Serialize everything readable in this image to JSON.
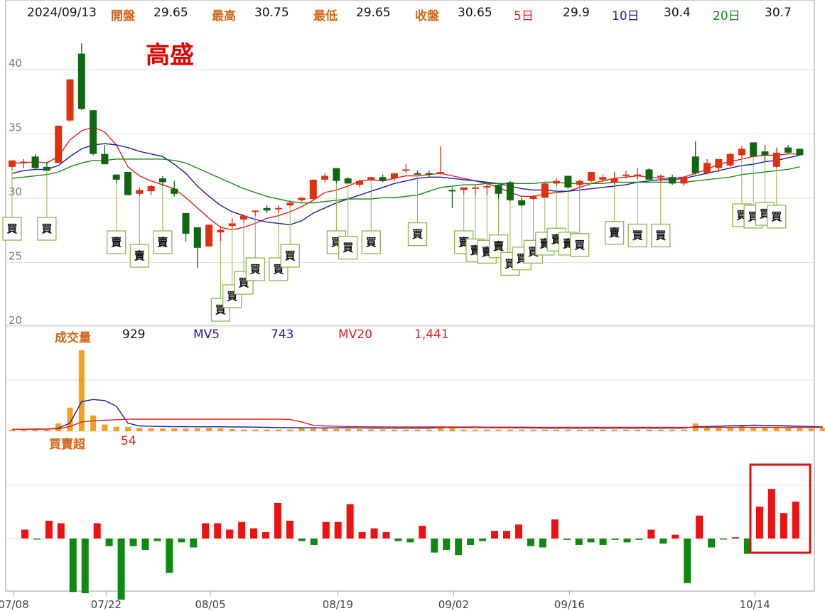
{
  "header": {
    "date": "2024/09/13",
    "open_label": "開盤",
    "open": "29.65",
    "high_label": "最高",
    "high": "30.75",
    "low_label": "最低",
    "low": "29.65",
    "close_label": "收盤",
    "close": "30.65",
    "ma5_label": "5日",
    "ma5": "29.9",
    "ma10_label": "10日",
    "ma10": "30.4",
    "ma20_label": "20日",
    "ma20": "30.7"
  },
  "stock_name": "高盛",
  "volume_panel": {
    "label": "成交量",
    "value": "929",
    "mv5_label": "MV5",
    "mv5": "743",
    "mv20_label": "MV20",
    "mv20": "1,441"
  },
  "net_panel": {
    "label": "買賣超",
    "value": "54"
  },
  "signal_text": {
    "buy": "買",
    "sell": "賣"
  },
  "colors": {
    "up": "#e03010",
    "down": "#116611",
    "ma5": "#e02020",
    "ma10": "#1a1ab0",
    "ma20": "#1a8a1a",
    "volume": "#f5a020",
    "net_pos": "#ee1111",
    "net_neg": "#118811",
    "label_orange": "#d2691e",
    "highlight_box": "#dd1111",
    "signal_border": "#8ab84a"
  },
  "chart_data": [
    {
      "type": "candlestick",
      "title": "",
      "y_ticks": [
        20,
        25,
        30,
        35,
        40
      ],
      "ylim": [
        20,
        42
      ],
      "x_ticks": [
        "07/08",
        "07/22",
        "08/05",
        "08/19",
        "09/02",
        "09/16",
        "10/14"
      ],
      "x_tick_positions": [
        0,
        8,
        17,
        28,
        38,
        48,
        64
      ],
      "ohlc": [
        [
          32.0,
          32.5,
          31.8,
          32.5
        ],
        [
          32.3,
          32.6,
          31.9,
          32.4
        ],
        [
          32.8,
          33.0,
          31.8,
          31.9
        ],
        [
          32.0,
          32.4,
          31.7,
          31.7
        ],
        [
          32.3,
          35.2,
          32.3,
          35.2
        ],
        [
          35.6,
          38.8,
          35.5,
          38.8
        ],
        [
          40.8,
          41.6,
          36.4,
          36.5
        ],
        [
          36.4,
          36.4,
          32.9,
          33.0
        ],
        [
          33.0,
          33.7,
          32.2,
          32.2
        ],
        [
          31.4,
          31.4,
          30.7,
          31.0
        ],
        [
          31.6,
          31.6,
          29.8,
          29.8
        ],
        [
          29.9,
          30.4,
          29.7,
          30.2
        ],
        [
          30.1,
          30.6,
          29.8,
          30.5
        ],
        [
          31.1,
          31.3,
          30.5,
          30.8
        ],
        [
          30.3,
          30.9,
          29.7,
          29.9
        ],
        [
          28.4,
          28.4,
          26.2,
          26.8
        ],
        [
          27.3,
          27.3,
          24.1,
          25.7
        ],
        [
          25.8,
          27.5,
          25.8,
          27.5
        ],
        [
          26.9,
          27.4,
          26.2,
          27.1
        ],
        [
          27.4,
          28.0,
          27.2,
          27.6
        ],
        [
          27.9,
          28.3,
          27.7,
          28.2
        ],
        [
          28.5,
          28.6,
          28.2,
          28.6
        ],
        [
          28.8,
          29.0,
          28.4,
          28.6
        ],
        [
          28.7,
          29.0,
          28.4,
          28.8
        ],
        [
          29.0,
          29.4,
          28.9,
          29.2
        ],
        [
          29.4,
          29.6,
          29.3,
          29.6
        ],
        [
          29.5,
          31.0,
          29.4,
          31.0
        ],
        [
          31.0,
          31.5,
          30.8,
          31.3
        ],
        [
          31.9,
          31.9,
          30.7,
          30.9
        ],
        [
          31.1,
          31.2,
          30.7,
          30.7
        ],
        [
          30.6,
          31.0,
          30.4,
          30.9
        ],
        [
          31.0,
          31.2,
          30.9,
          31.2
        ],
        [
          31.2,
          31.4,
          30.8,
          30.9
        ],
        [
          31.1,
          31.5,
          30.9,
          31.5
        ],
        [
          31.7,
          32.2,
          31.5,
          31.8
        ],
        [
          31.5,
          31.7,
          31.4,
          31.4
        ],
        [
          31.5,
          31.7,
          31.2,
          31.4
        ],
        [
          31.5,
          33.6,
          31.4,
          31.6
        ],
        [
          30.2,
          30.4,
          28.8,
          30.1
        ],
        [
          30.2,
          30.4,
          29.9,
          30.4
        ],
        [
          30.4,
          30.6,
          29.8,
          30.4
        ],
        [
          30.5,
          30.7,
          29.8,
          30.5
        ],
        [
          30.6,
          30.7,
          29.5,
          29.9
        ],
        [
          30.8,
          30.9,
          29.3,
          29.4
        ],
        [
          29.4,
          29.6,
          28.9,
          29.0
        ],
        [
          29.5,
          29.8,
          29.4,
          29.7
        ],
        [
          29.6,
          30.8,
          29.6,
          30.7
        ],
        [
          30.7,
          31.1,
          30.5,
          30.9
        ],
        [
          31.3,
          31.3,
          30.3,
          30.4
        ],
        [
          30.6,
          31.0,
          30.4,
          30.9
        ],
        [
          30.9,
          31.6,
          30.8,
          31.6
        ],
        [
          31.0,
          31.4,
          30.8,
          31.2
        ],
        [
          30.8,
          31.6,
          30.6,
          31.1
        ],
        [
          31.3,
          31.7,
          31.1,
          31.4
        ],
        [
          31.4,
          31.9,
          31.0,
          31.4
        ],
        [
          31.8,
          31.9,
          31.0,
          31.0
        ],
        [
          31.2,
          31.4,
          30.8,
          31.3
        ],
        [
          31.2,
          31.4,
          30.6,
          30.7
        ],
        [
          30.7,
          31.2,
          30.5,
          31.2
        ],
        [
          32.8,
          34.0,
          31.4,
          31.5
        ],
        [
          31.5,
          32.6,
          31.4,
          32.3
        ],
        [
          31.9,
          32.6,
          31.6,
          32.6
        ],
        [
          32.1,
          33.1,
          32.0,
          33.0
        ],
        [
          32.9,
          33.6,
          32.7,
          33.4
        ],
        [
          33.9,
          33.9,
          32.8,
          32.8
        ],
        [
          33.2,
          33.7,
          32.4,
          32.9
        ],
        [
          32.0,
          33.5,
          31.9,
          33.1
        ],
        [
          33.5,
          33.7,
          33.0,
          33.1
        ],
        [
          33.4,
          33.4,
          32.9,
          32.9
        ]
      ],
      "series": [
        {
          "name": "5日",
          "values": [
            32.3,
            32.3,
            32.4,
            32.3,
            32.8,
            34.1,
            34.8,
            35.1,
            34.7,
            33.7,
            32.0,
            31.3,
            30.9,
            30.6,
            30.3,
            29.6,
            28.8,
            28.0,
            27.3,
            27.1,
            27.3,
            27.6,
            28.0,
            28.2,
            28.5,
            28.9,
            29.4,
            30.0,
            30.2,
            30.5,
            30.9,
            31.0,
            30.9,
            31.1,
            31.3,
            31.3,
            31.4,
            31.5,
            31.3,
            31.1,
            30.9,
            30.7,
            30.4,
            30.0,
            29.7,
            29.7,
            29.9,
            30.0,
            30.1,
            30.4,
            30.7,
            30.9,
            31.1,
            31.2,
            31.3,
            31.2,
            31.1,
            31.1,
            31.2,
            31.5,
            31.8,
            32.2,
            32.4,
            32.6,
            32.8,
            32.9,
            32.9,
            33.0,
            33.0
          ]
        },
        {
          "name": "10日",
          "values": [
            31.5,
            31.7,
            31.8,
            31.8,
            32.1,
            32.8,
            33.4,
            33.7,
            33.8,
            33.7,
            33.5,
            33.2,
            33.0,
            32.8,
            32.2,
            31.5,
            30.5,
            29.7,
            29.0,
            28.5,
            28.2,
            27.9,
            27.7,
            27.6,
            27.5,
            27.8,
            28.4,
            28.8,
            29.2,
            29.5,
            29.8,
            30.1,
            30.4,
            30.7,
            30.9,
            31.1,
            31.2,
            31.2,
            31.1,
            31.0,
            30.9,
            30.8,
            30.7,
            30.5,
            30.3,
            30.2,
            30.2,
            30.1,
            30.1,
            30.2,
            30.3,
            30.4,
            30.5,
            30.6,
            30.8,
            30.9,
            31.0,
            31.0,
            31.1,
            31.3,
            31.5,
            31.7,
            31.9,
            32.1,
            32.2,
            32.4,
            32.5,
            32.7,
            32.9
          ]
        },
        {
          "name": "20日",
          "values": [
            31.1,
            31.2,
            31.3,
            31.4,
            31.6,
            32.0,
            32.3,
            32.5,
            32.5,
            32.6,
            32.6,
            32.6,
            32.6,
            32.6,
            32.5,
            32.3,
            31.9,
            31.5,
            31.1,
            30.7,
            30.3,
            30.0,
            29.7,
            29.5,
            29.3,
            29.2,
            29.2,
            29.3,
            29.4,
            29.5,
            29.5,
            29.5,
            29.6,
            29.6,
            29.7,
            29.8,
            30.1,
            30.4,
            30.5,
            30.6,
            30.6,
            30.7,
            30.7,
            30.7,
            30.7,
            30.7,
            30.8,
            30.8,
            30.7,
            30.7,
            30.7,
            30.7,
            30.8,
            30.8,
            30.8,
            30.8,
            30.8,
            30.8,
            30.8,
            30.9,
            31.0,
            31.1,
            31.2,
            31.4,
            31.5,
            31.6,
            31.7,
            31.8,
            32.0
          ]
        }
      ],
      "signals": [
        {
          "i": 0,
          "type": "buy",
          "level": 0
        },
        {
          "i": 3,
          "type": "buy",
          "level": 0
        },
        {
          "i": 9,
          "type": "sell",
          "level": 1
        },
        {
          "i": 11,
          "type": "sell",
          "level": 2
        },
        {
          "i": 13,
          "type": "sell",
          "level": 1
        },
        {
          "i": 18,
          "type": "buy",
          "level": 6
        },
        {
          "i": 19,
          "type": "buy",
          "level": 5
        },
        {
          "i": 20,
          "type": "buy",
          "level": 4
        },
        {
          "i": 21,
          "type": "buy",
          "level": 3
        },
        {
          "i": 23,
          "type": "buy",
          "level": 3
        },
        {
          "i": 24,
          "type": "buy",
          "level": 2
        },
        {
          "i": 28,
          "type": "buy",
          "level": 1
        },
        {
          "i": 29,
          "type": "buy",
          "level": 1.4
        },
        {
          "i": 31,
          "type": "buy",
          "level": 1
        },
        {
          "i": 35,
          "type": "buy",
          "level": 0.4
        },
        {
          "i": 39,
          "type": "sell",
          "level": 1
        },
        {
          "i": 40,
          "type": "sell",
          "level": 1.6
        },
        {
          "i": 41,
          "type": "sell",
          "level": 1.7
        },
        {
          "i": 42,
          "type": "sell",
          "level": 1.3
        },
        {
          "i": 43,
          "type": "buy",
          "level": 2.6
        },
        {
          "i": 44,
          "type": "buy",
          "level": 2.2
        },
        {
          "i": 45,
          "type": "buy",
          "level": 1.7
        },
        {
          "i": 46,
          "type": "sell",
          "level": 1.1
        },
        {
          "i": 47,
          "type": "sell",
          "level": 0.8
        },
        {
          "i": 48,
          "type": "sell",
          "level": 1.1
        },
        {
          "i": 49,
          "type": "buy",
          "level": 1.2
        },
        {
          "i": 52,
          "type": "sell",
          "level": 0.3
        },
        {
          "i": 54,
          "type": "buy",
          "level": 0.5
        },
        {
          "i": 56,
          "type": "buy",
          "level": 0.5
        },
        {
          "i": 63,
          "type": "buy",
          "level": -1
        },
        {
          "i": 64,
          "type": "buy",
          "level": -0.9
        },
        {
          "i": 65,
          "type": "buy",
          "level": -1.1
        },
        {
          "i": 66,
          "type": "buy",
          "level": -0.9
        }
      ]
    },
    {
      "type": "bar",
      "title": "成交量",
      "values": [
        60,
        60,
        80,
        80,
        700,
        2100,
        7200,
        1400,
        600,
        400,
        380,
        300,
        280,
        250,
        250,
        250,
        280,
        300,
        280,
        200,
        150,
        150,
        150,
        150,
        150,
        300,
        300,
        250,
        200,
        200,
        180,
        160,
        160,
        150,
        150,
        150,
        150,
        420,
        280,
        150,
        150,
        150,
        150,
        150,
        150,
        150,
        150,
        150,
        150,
        150,
        150,
        150,
        150,
        150,
        150,
        150,
        150,
        150,
        150,
        700,
        350,
        300,
        400,
        450,
        350,
        300,
        320,
        300,
        280,
        250,
        260
      ],
      "series": [
        {
          "name": "MV5",
          "values": [
            50,
            50,
            60,
            60,
            150,
            600,
            2500,
            2700,
            2600,
            2100,
            600,
            350,
            320,
            300,
            280,
            280,
            270,
            270,
            270,
            260,
            250,
            240,
            220,
            200,
            190,
            180,
            180,
            170,
            180,
            190,
            170,
            160,
            160,
            150,
            150,
            160,
            160,
            200,
            210,
            200,
            200,
            200,
            190,
            180,
            170,
            170,
            160,
            160,
            160,
            160,
            160,
            160,
            160,
            150,
            150,
            150,
            150,
            150,
            150,
            270,
            300,
            320,
            360,
            380,
            420,
            400,
            380,
            350,
            320,
            300,
            250
          ]
        },
        {
          "name": "MV20",
          "values": [
            50,
            50,
            60,
            60,
            100,
            300,
            700,
            800,
            850,
            900,
            950,
            950,
            950,
            950,
            950,
            950,
            950,
            950,
            950,
            950,
            950,
            950,
            950,
            950,
            920,
            700,
            400,
            350,
            320,
            300,
            280,
            270,
            260,
            250,
            250,
            250,
            250,
            250,
            250,
            250,
            250,
            240,
            240,
            240,
            240,
            230,
            220,
            220,
            220,
            220,
            220,
            220,
            220,
            220,
            220,
            220,
            220,
            220,
            220,
            220,
            220,
            220,
            220,
            220,
            220,
            220,
            220,
            220,
            220,
            220,
            220
          ]
        }
      ]
    },
    {
      "type": "bar",
      "title": "買賣超",
      "values": [
        7,
        -0.5,
        14,
        12,
        -42,
        -43,
        12,
        -6,
        -48,
        -6,
        -9,
        -2,
        -27,
        -3,
        -7,
        12,
        12,
        7,
        13,
        8,
        5,
        28,
        14,
        -2,
        -5,
        13,
        13,
        27,
        5,
        8,
        5,
        -2,
        -3,
        10,
        -11,
        -9,
        -13,
        -5,
        -2,
        6,
        6,
        11,
        -6,
        -7,
        15,
        -1,
        -5,
        -3,
        -5,
        -1,
        -3,
        -1,
        7,
        -4,
        3,
        -35,
        18,
        -7,
        -0.5,
        1,
        -12,
        25,
        39,
        20,
        29
      ]
    }
  ]
}
